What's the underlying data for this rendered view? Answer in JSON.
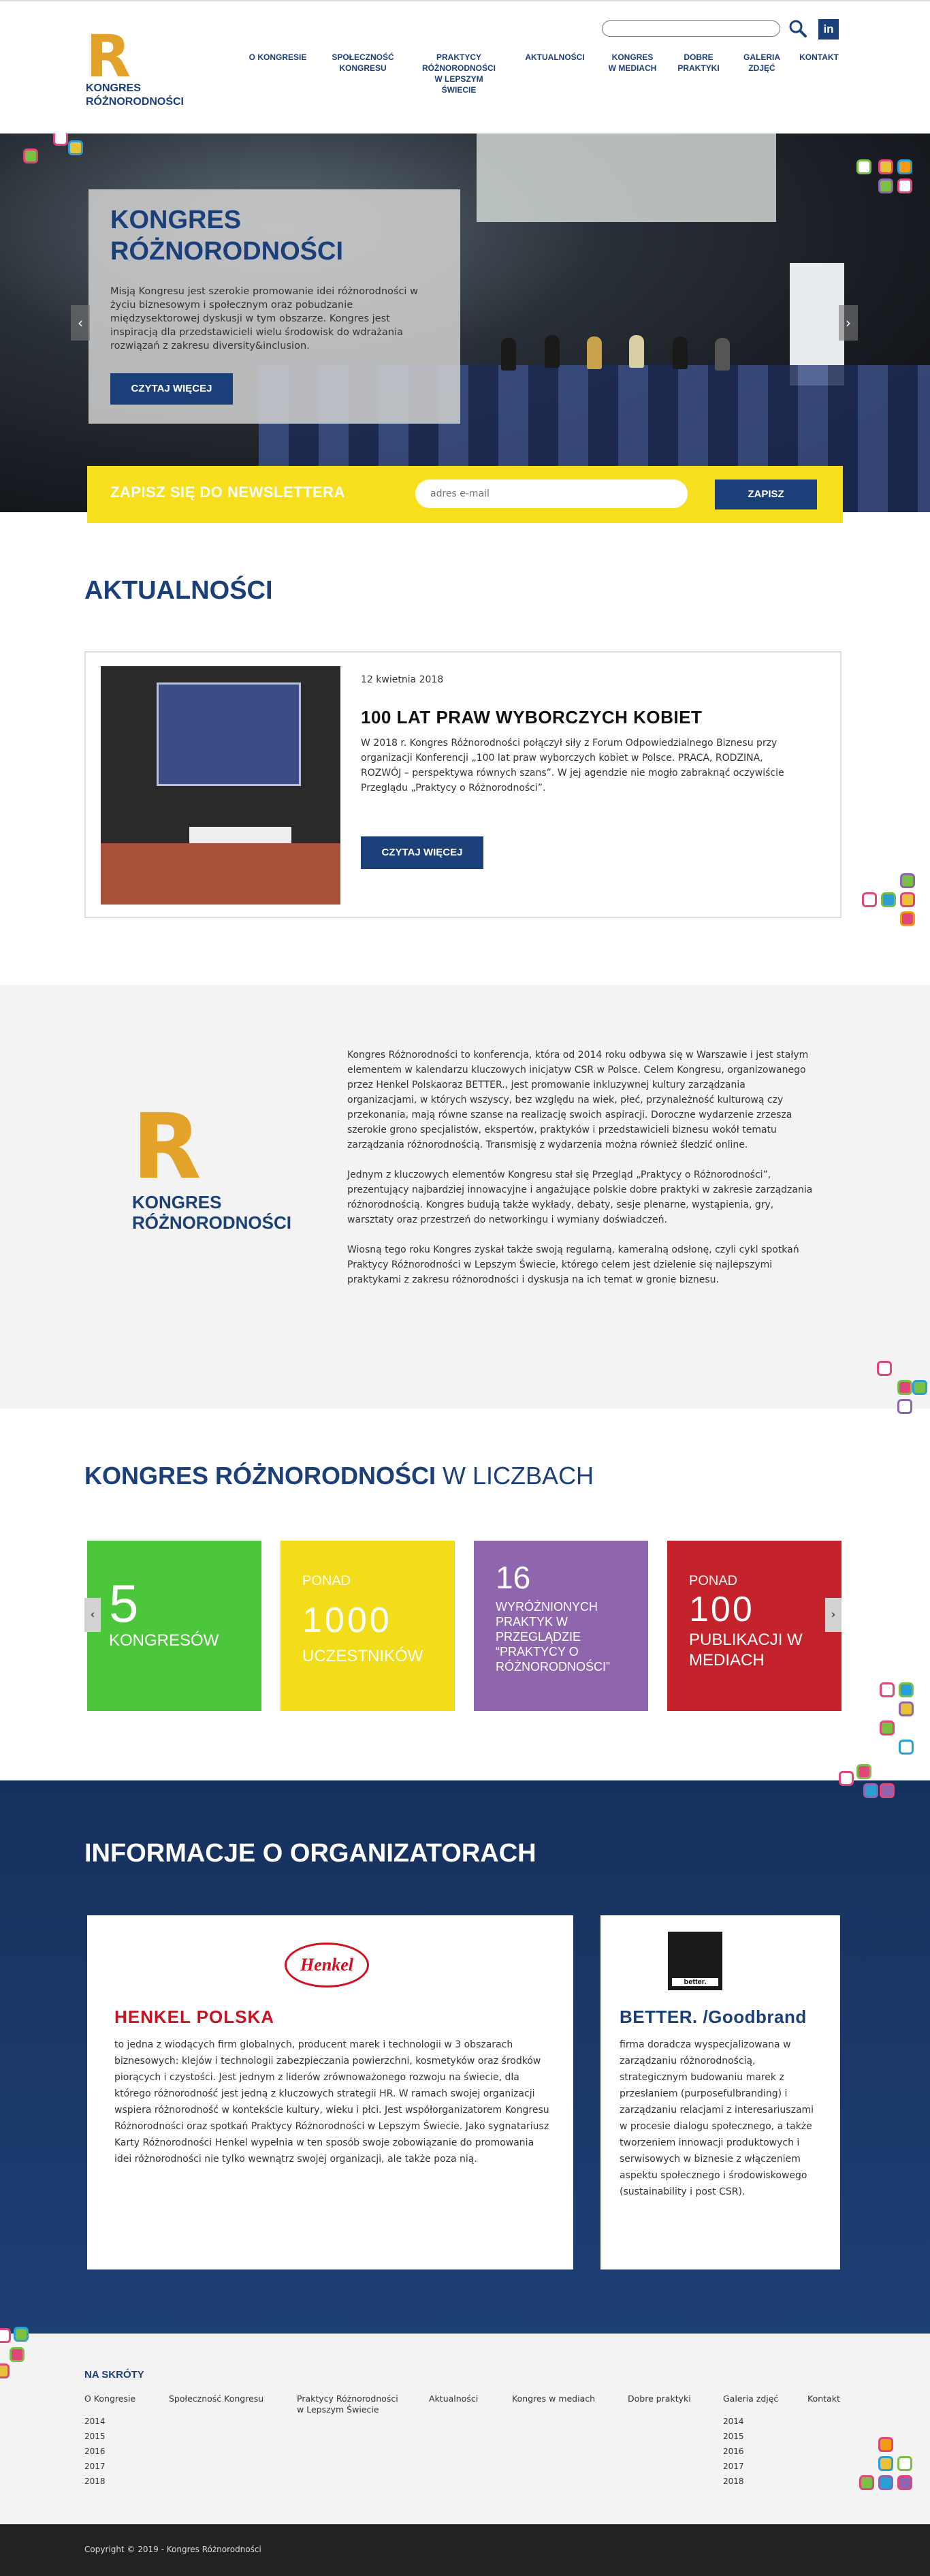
{
  "header": {
    "logo": {
      "letter": "R",
      "line1": "KONGRES",
      "line2": "RÓŻNORODNOŚCI"
    },
    "search": {
      "placeholder": "",
      "icon": "search-icon"
    },
    "linkedin": {
      "label": "in",
      "icon": "linkedin-icon"
    },
    "nav": [
      {
        "label": "O KONGRESIE"
      },
      {
        "label": "SPOŁECZNOŚĆ\nKONGRESU"
      },
      {
        "label": "PRAKTYCY\nRÓŻNORODNOŚCI\nW LEPSZYM\nŚWIECIE"
      },
      {
        "label": "AKTUALNOŚCI"
      },
      {
        "label": "KONGRES\nW MEDIACH"
      },
      {
        "label": "DOBRE\nPRAKTYKI"
      },
      {
        "label": "GALERIA\nZDJĘĆ"
      },
      {
        "label": "KONTAKT"
      }
    ]
  },
  "hero": {
    "title": "KONGRES RÓŻNORODNOŚCI",
    "description": "Misją Kongresu jest szerokie promowanie idei różnorodności w życiu biznesowym i społecznym oraz pobudzanie międzysektorowej dyskusji w tym obszarze. Kongres jest inspiracją dla przedstawicieli wielu środowisk do wdrażania rozwiązań z zakresu diversity&inclusion.",
    "button": "CZYTAJ WIĘCEJ",
    "arrow_prev": "‹",
    "arrow_next": "›"
  },
  "newsletter": {
    "title": "ZAPISZ SIĘ DO NEWSLETTERA",
    "placeholder": "adres e-mail",
    "button": "ZAPISZ"
  },
  "news": {
    "heading": "AKTUALNOŚCI",
    "date": "12 kwietnia 2018",
    "title": "100 LAT PRAW WYBORCZYCH KOBIET",
    "text": "W 2018 r. Kongres Różnorodności połączył siły z Forum Odpowiedzialnego Biznesu przy organizacji Konferencji „100 lat praw wyborczych kobiet w Polsce. PRACA, RODZINA, ROZWÓJ – perspektywa równych szans”. W jej agendzie nie mogło zabraknąć oczywiście Przeglądu „Praktycy o Różnorodności”.",
    "button": "CZYTAJ WIĘCEJ"
  },
  "about": {
    "logo": {
      "letter": "R",
      "line1": "KONGRES",
      "line2": "RÓŻNORODNOŚCI"
    },
    "paragraphs": [
      "Kongres Różnorodności to konferencja, która od 2014 roku odbywa się w Warszawie i jest stałym elementem w kalendarzu kluczowych inicjatyw CSR w Polsce. Celem Kongresu, organizowanego przez Henkel Polskaoraz BETTER., jest promowanie inkluzywnej kultury zarządzania organizacjami, w których wszyscy, bez względu na wiek, płeć, przynależność kulturową czy przekonania, mają równe szanse na realizację swoich aspiracji. Doroczne wydarzenie zrzesza szerokie grono specjalistów, ekspertów, praktyków i przedstawicieli biznesu wokół tematu zarządzania różnorodnością. Transmisję z wydarzenia można również śledzić online.",
      "Jednym z kluczowych elementów Kongresu stał się Przegląd „Praktycy o Różnorodności”, prezentujący najbardziej innowacyjne i angażujące polskie dobre praktyki w zakresie zarządzania różnorodnością. Kongres budują także wykłady, debaty, sesje plenarne, wystąpienia, gry, warsztaty oraz przestrzeń do networkingu i wymiany doświadczeń.",
      "Wiosną tego roku Kongres zyskał także swoją regularną, kameralną odsłonę, czyli cykl spotkań Praktycy Różnorodności w Lepszym Świecie, którego celem jest dzielenie się najlepszymi praktykami z zakresu różnorodności i dyskusja na ich temat w gronie biznesu."
    ]
  },
  "numbers": {
    "heading_bold": "KONGRES RÓŻNORODNOŚCI",
    "heading_light": "W LICZBACH",
    "arrow_prev": "‹",
    "arrow_next": "›",
    "items": [
      {
        "prefix": "",
        "value": "5",
        "label": "KONGRESÓW",
        "color": "#4cc63a"
      },
      {
        "prefix": "PONAD",
        "value": "1000",
        "label": "UCZESTNIKÓW",
        "color": "#f3dc1a"
      },
      {
        "prefix": "",
        "value": "16",
        "label": "WYRÓŻNIONYCH PRAKTYK W PRZEGLĄDZIE “PRAKTYCY O RÓŻNORODNOŚCI”",
        "color": "#8f65ad"
      },
      {
        "prefix": "PONAD",
        "value": "100",
        "label": "PUBLIKACJI W MEDIACH",
        "color": "#c4232c"
      }
    ]
  },
  "organizers": {
    "heading": "INFORMACJE O ORGANIZATORACH",
    "henkel": {
      "logo": "Henkel",
      "name": "HENKEL POLSKA",
      "text": "to jedna z wiodących firm globalnych, producent marek i technologii w 3 obszarach biznesowych: klejów i technologii zabezpieczania powierzchni, kosmetyków oraz środków piorących i czystości. Jest jednym z liderów zrównoważonego rozwoju na świecie, dla którego różnorodność jest jedną z kluczowych strategii HR. W ramach swojej organizacji wspiera różnorodność w kontekście kultury, wieku i płci. Jest współorganizatorem Kongresu Różnorodności oraz spotkań Praktycy Różnorodności w Lepszym Świecie. Jako sygnatariusz Karty Różnorodności Henkel wypełnia w ten sposób swoje zobowiązanie do promowania idei różnorodności nie tylko wewnątrz swojej organizacji, ale także poza nią."
    },
    "better": {
      "logo": "better.",
      "name": "BETTER. /Goodbrand",
      "text": "firma doradcza wyspecjalizowana w zarządzaniu różnorodnością, strategicznym budowaniu marek z przesłaniem (purposefulbranding) i zarządzaniu relacjami z interesariuszami w procesie dialogu społecznego, a także tworzeniem innowacji produktowych i serwisowych w biznesie z włączeniem aspektu społecznego i środowiskowego (sustainability i post CSR)."
    }
  },
  "footer": {
    "heading": "NA SKRÓTY",
    "links": [
      {
        "label": "O Kongresie"
      },
      {
        "label": "Społeczność Kongresu"
      },
      {
        "label": "Praktycy Różnorodności\nw Lepszym Świecie"
      },
      {
        "label": "Aktualności"
      },
      {
        "label": "Kongres w mediach"
      },
      {
        "label": "Dobre praktyki"
      },
      {
        "label": "Galeria zdjęć"
      },
      {
        "label": "Kontakt"
      }
    ],
    "years_col1": [
      "2014",
      "2015",
      "2016",
      "2017",
      "2018"
    ],
    "years_col2": [
      "2014",
      "2015",
      "2016",
      "2017",
      "2018"
    ],
    "copyright": "Copyright © 2019 - Kongres Różnorodności"
  },
  "colors": {
    "brand_blue": "#1b3f78",
    "newsletter_yellow": "#f7df1e",
    "henkel_red": "#c81420"
  }
}
